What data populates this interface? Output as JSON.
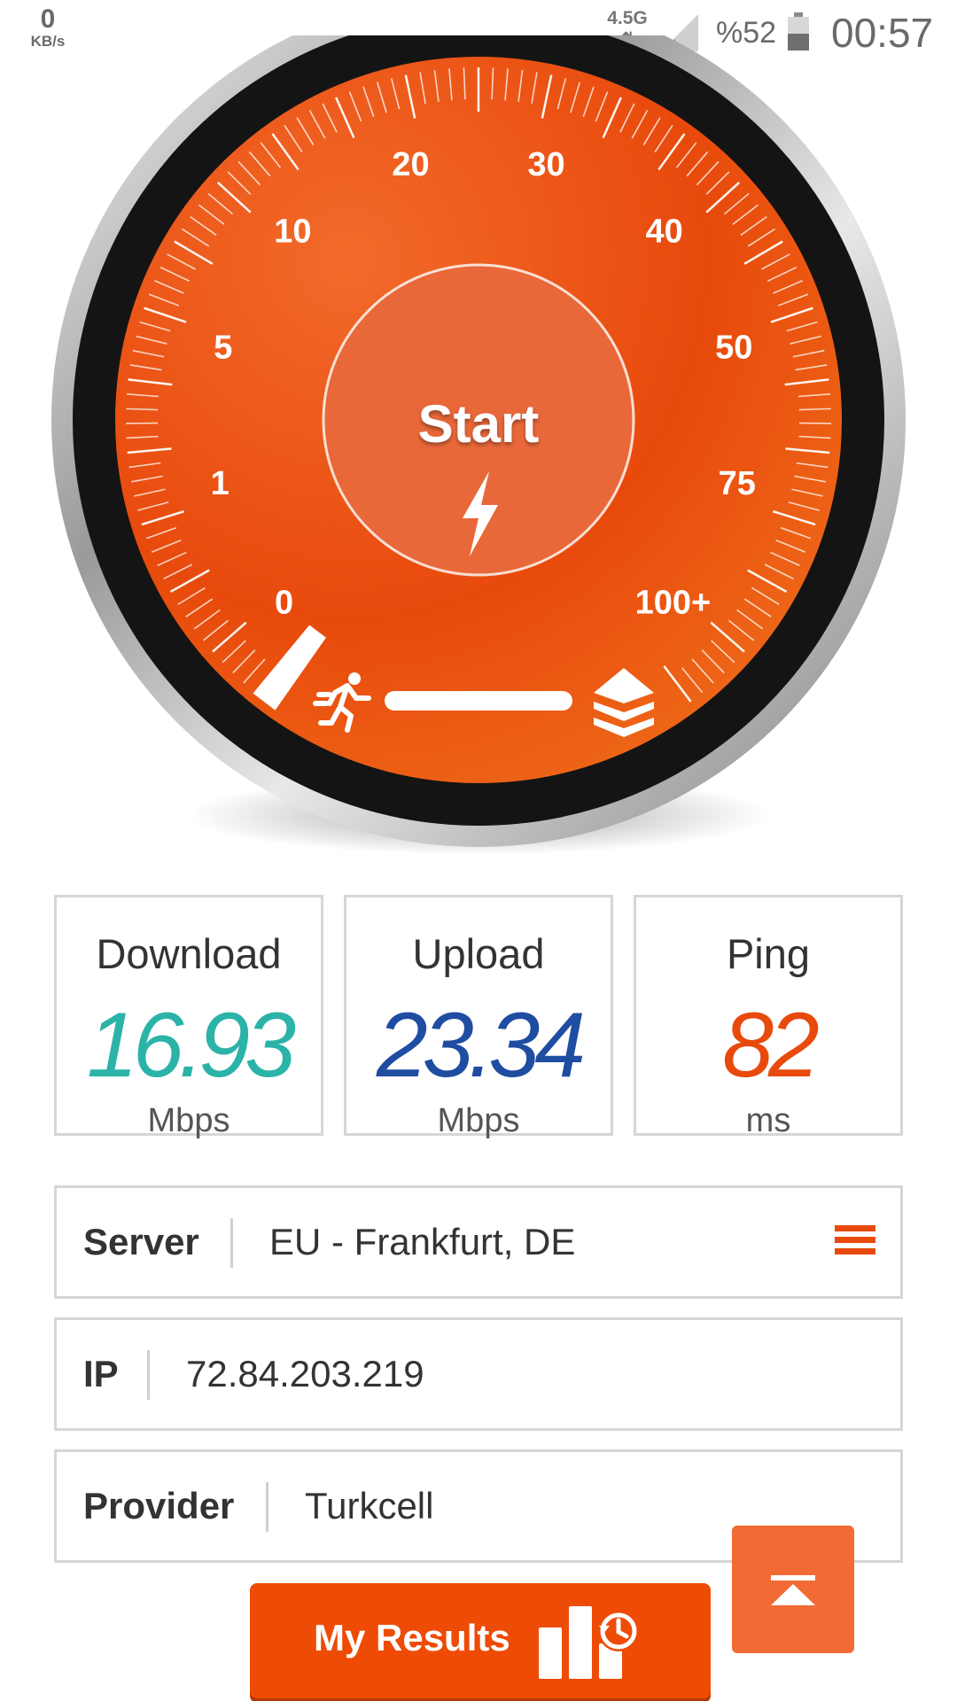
{
  "status_bar": {
    "speed_value": "0",
    "speed_unit": "KB/s",
    "network_type": "4.5G",
    "network_arrows": "⇅",
    "battery_percent": "%52",
    "time": "00:57"
  },
  "gauge": {
    "start_label": "Start",
    "scale_labels": [
      "0",
      "1",
      "5",
      "10",
      "20",
      "30",
      "40",
      "50",
      "75",
      "100+"
    ],
    "progress": 0,
    "colors": {
      "face": "#e84a0c",
      "bezel": "#1a1a1a",
      "rim": "#a9a9a9"
    }
  },
  "stats": {
    "download": {
      "title": "Download",
      "value": "16.93",
      "unit": "Mbps",
      "color": "#2bb3a8"
    },
    "upload": {
      "title": "Upload",
      "value": "23.34",
      "unit": "Mbps",
      "color": "#1e4da1"
    },
    "ping": {
      "title": "Ping",
      "value": "82",
      "unit": "ms",
      "color": "#e84a0c"
    }
  },
  "info": {
    "server": {
      "label": "Server",
      "value": "EU - Frankfurt, DE"
    },
    "ip": {
      "label": "IP",
      "value": "72.84.203.219"
    },
    "provider": {
      "label": "Provider",
      "value": "Turkcell"
    }
  },
  "buttons": {
    "my_results": "My Results"
  },
  "icons": {
    "menu": "hamburger-menu-icon",
    "scroll_top": "scroll-to-top-icon",
    "results": "bar-chart-history-icon",
    "bolt": "lightning-bolt-icon",
    "runner": "running-person-icon",
    "layers": "layers-icon"
  },
  "accent_color": "#ee4b06"
}
